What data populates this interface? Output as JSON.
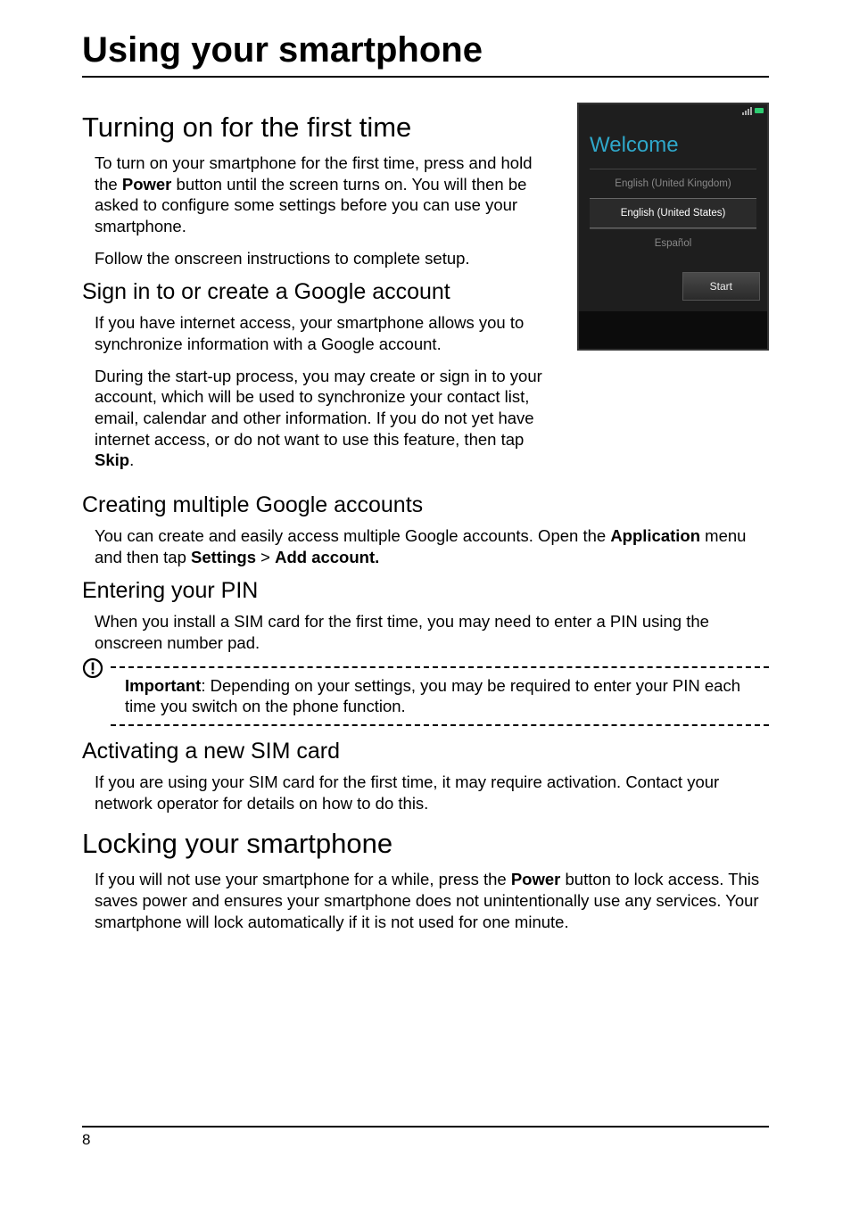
{
  "page_title": "Using your smartphone",
  "section_turning_on": {
    "heading": "Turning on for the first time",
    "p1_a": "To turn on your smartphone for the first time, press and hold the ",
    "p1_power": "Power",
    "p1_b": " button until the screen turns on. You will then be asked to configure some settings before you can use your smartphone.",
    "p2": "Follow the onscreen instructions to complete setup."
  },
  "section_sign_in": {
    "heading": "Sign in to or create a Google account",
    "p1": "If you have internet access, your smartphone allows you to synchronize information with a Google account.",
    "p2_a": "During the start-up process, you may create or sign in to your account, which will be used to synchronize your contact list, email, calendar and other information. If you do not yet have internet access, or do not want to use this feature, then tap ",
    "p2_skip": "Skip",
    "p2_b": "."
  },
  "section_multiple": {
    "heading": "Creating multiple Google accounts",
    "p1_a": "You can create and easily access multiple Google accounts. Open the ",
    "p1_app": "Application",
    "p1_b": " menu and then tap ",
    "p1_settings": "Settings",
    "p1_gt": " > ",
    "p1_add": "Add account."
  },
  "section_pin": {
    "heading": "Entering your PIN",
    "p1": "When you install a SIM card for the first time, you may need to enter a PIN using the onscreen number pad."
  },
  "important_box": {
    "label": "Important",
    "text": ": Depending on your settings, you may be required to enter your PIN each time you switch on the phone function."
  },
  "section_sim": {
    "heading": "Activating a new SIM card",
    "p1": "If you are using your SIM card for the first time, it may require activation. Contact your network operator for details on how to do this."
  },
  "section_locking": {
    "heading": "Locking your smartphone",
    "p1_a": "If you will not use your smartphone for a while, press the ",
    "p1_power": "Power",
    "p1_b": " button to lock access. This saves power and ensures your smartphone does not unintentionally use any services. Your smartphone will lock automatically if it is not used for one minute."
  },
  "phone": {
    "welcome": "Welcome",
    "langs": [
      "English (United Kingdom)",
      "English (United States)",
      "Español"
    ],
    "selected_index": 1,
    "start": "Start"
  },
  "page_number": "8"
}
